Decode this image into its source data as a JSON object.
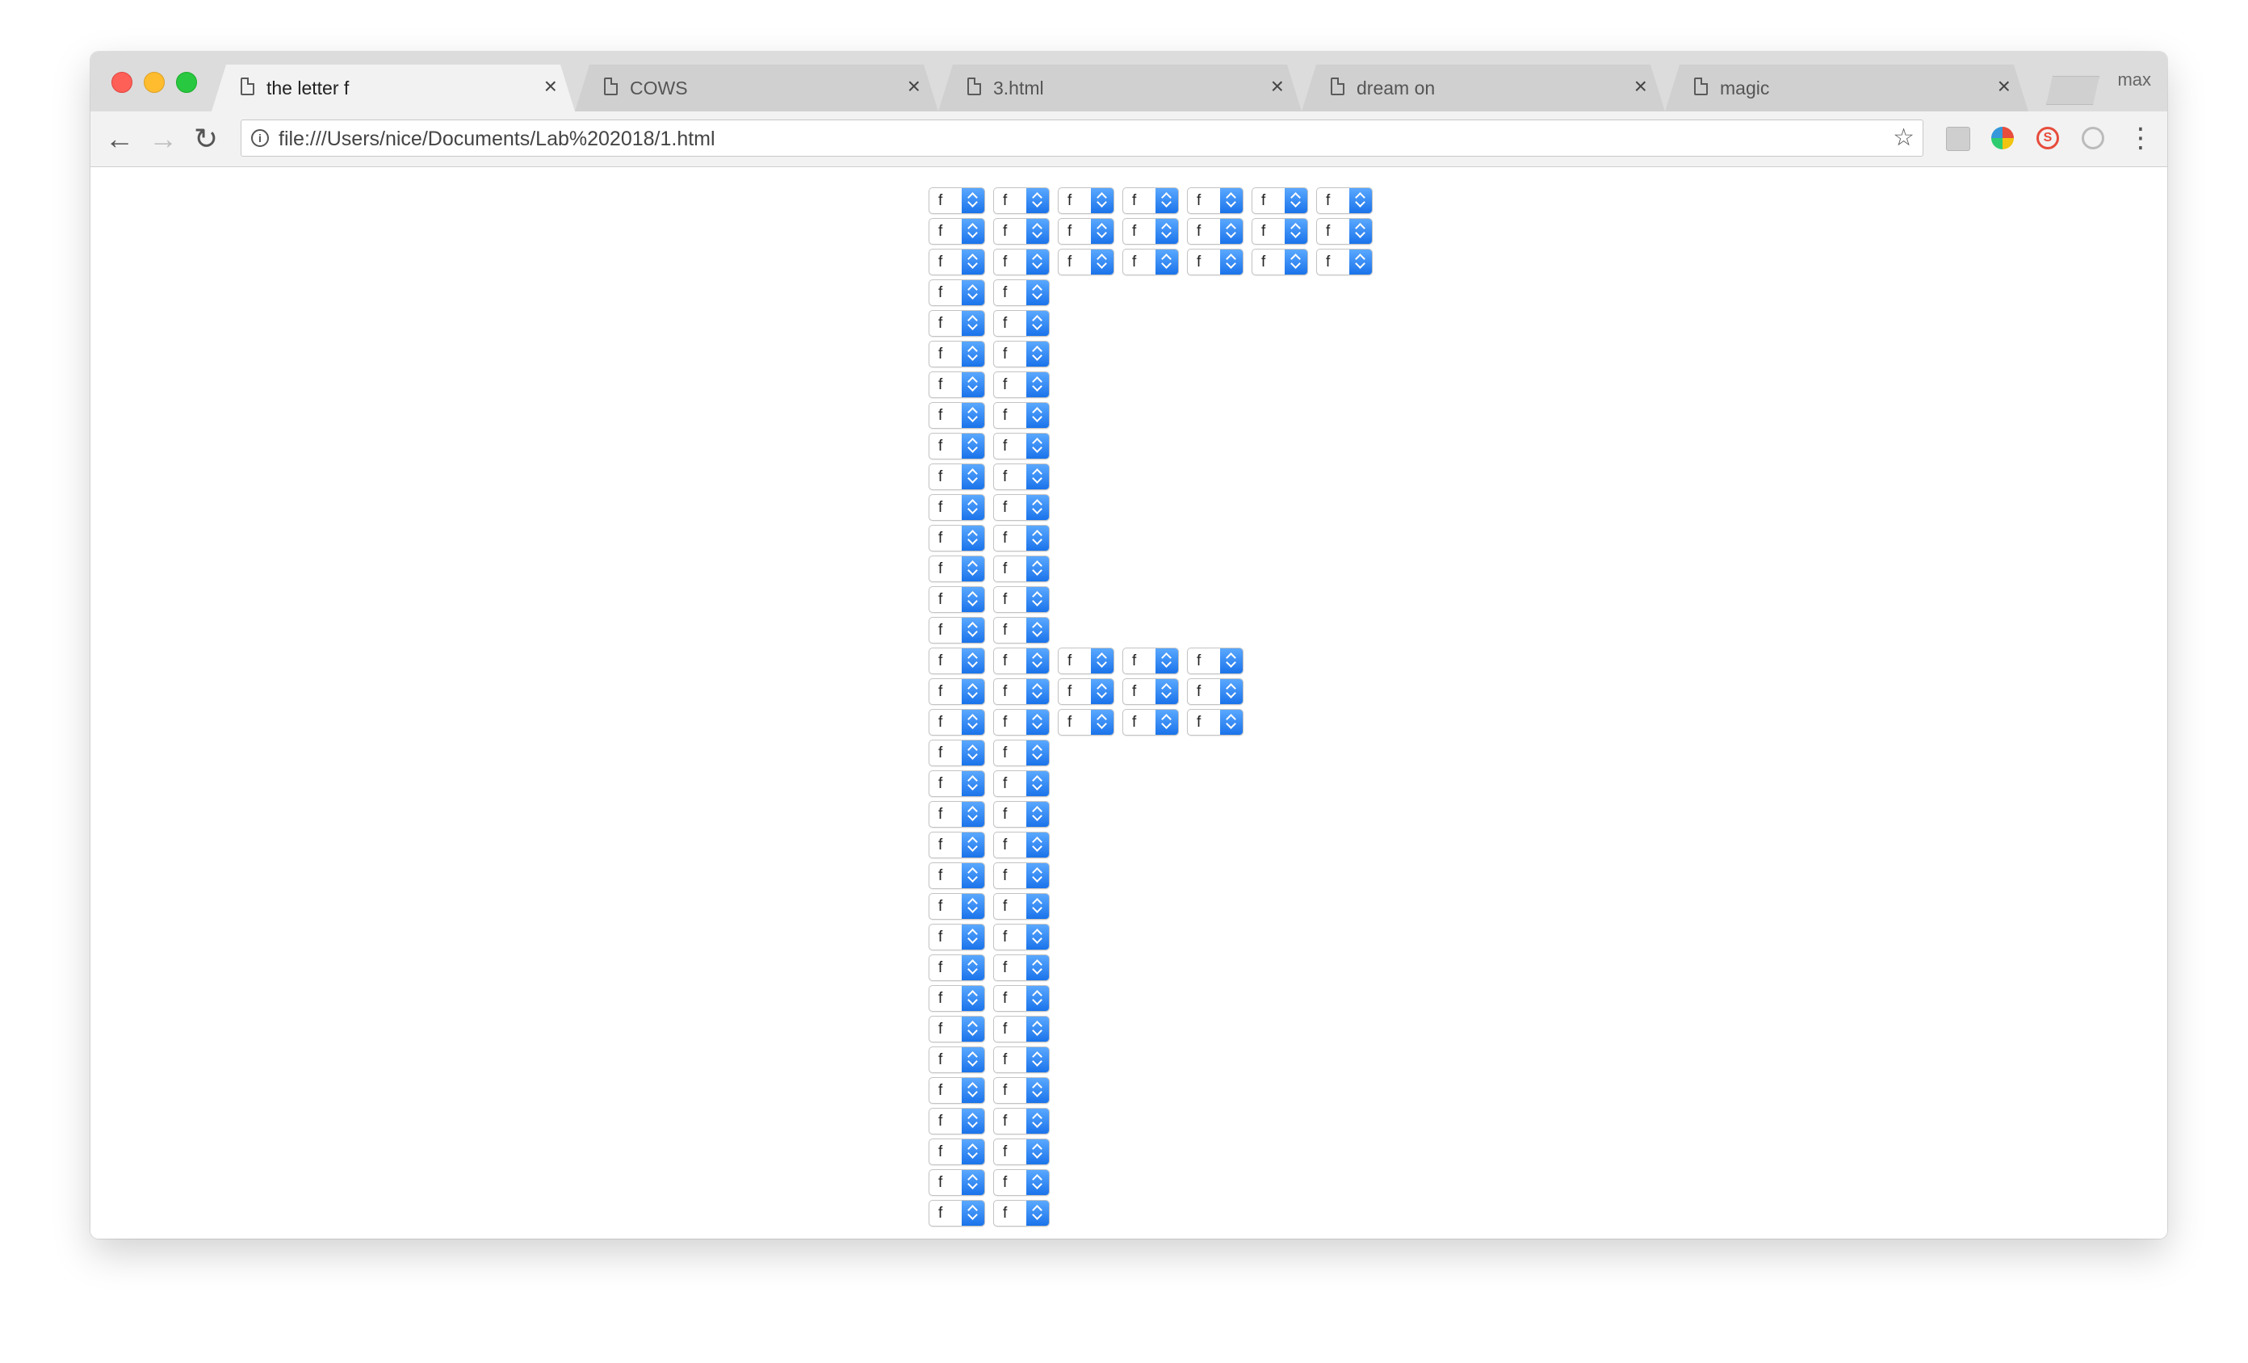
{
  "window": {
    "controls": [
      "close",
      "minimize",
      "maximize"
    ],
    "profile_label": "max"
  },
  "tabs": [
    {
      "title": "the letter f",
      "icon": "page-icon",
      "active": true
    },
    {
      "title": "COWS",
      "icon": "page-icon",
      "active": false
    },
    {
      "title": "3.html",
      "icon": "page-icon",
      "active": false
    },
    {
      "title": "dream on",
      "icon": "page-icon",
      "active": false
    },
    {
      "title": "magic",
      "icon": "page-icon",
      "active": false
    }
  ],
  "toolbar": {
    "back_icon": "←",
    "forward_icon": "→",
    "reload_icon": "↻",
    "url": "file:///Users/nice/Documents/Lab%202018/1.html",
    "star_icon": "☆",
    "menu_icon": "⋮",
    "extensions": [
      "nx-extension-icon",
      "color-wheel-extension-icon",
      "s-extension-icon",
      "sync-extension-icon"
    ]
  },
  "page": {
    "select_value": "f",
    "select_rows": [
      {
        "count": 7
      },
      {
        "count": 7
      },
      {
        "count": 7
      },
      {
        "count": 2
      },
      {
        "count": 2
      },
      {
        "count": 2
      },
      {
        "count": 2
      },
      {
        "count": 2
      },
      {
        "count": 2
      },
      {
        "count": 2
      },
      {
        "count": 2
      },
      {
        "count": 2
      },
      {
        "count": 2
      },
      {
        "count": 2
      },
      {
        "count": 2
      },
      {
        "count": 5
      },
      {
        "count": 5
      },
      {
        "count": 5
      },
      {
        "count": 2
      },
      {
        "count": 2
      },
      {
        "count": 2
      },
      {
        "count": 2
      },
      {
        "count": 2
      },
      {
        "count": 2
      },
      {
        "count": 2
      },
      {
        "count": 2
      },
      {
        "count": 2
      },
      {
        "count": 2
      },
      {
        "count": 2
      },
      {
        "count": 2
      },
      {
        "count": 2
      },
      {
        "count": 2
      },
      {
        "count": 2
      },
      {
        "count": 2
      }
    ],
    "colors": {
      "select_button": "#1a73ea",
      "tab_active": "#f2f2f2",
      "tab_inactive": "#d0d0d0"
    }
  }
}
